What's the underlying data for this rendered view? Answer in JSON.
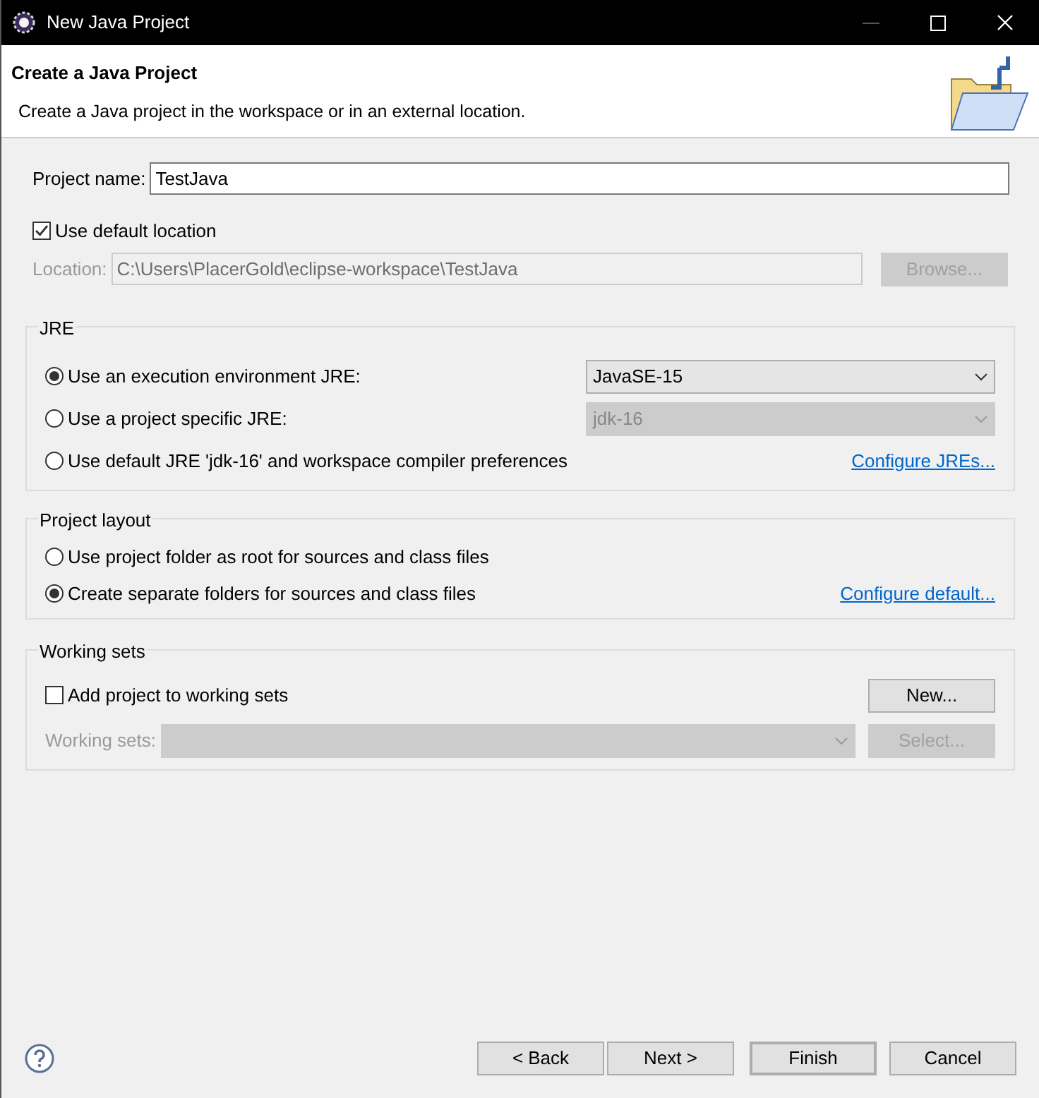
{
  "window": {
    "title": "New Java Project"
  },
  "header": {
    "title": "Create a Java Project",
    "description": "Create a Java project in the workspace or in an external location."
  },
  "project_name": {
    "label": "Project name:",
    "value": "TestJava"
  },
  "use_default_location": {
    "label": "Use default location",
    "checked": true
  },
  "location": {
    "label": "Location:",
    "value": "C:\\Users\\PlacerGold\\eclipse-workspace\\TestJava",
    "disabled": true,
    "button": {
      "label": "Browse...",
      "disabled": true
    }
  },
  "jre": {
    "title": "JRE",
    "options": [
      {
        "label": "Use an execution environment JRE:",
        "selected": true,
        "kind": "combo",
        "value": "JavaSE-15",
        "disabled": false
      },
      {
        "label": "Use a project specific JRE:",
        "selected": false,
        "kind": "combo",
        "value": "jdk-16",
        "disabled": true
      },
      {
        "label": "Use default JRE 'jdk-16' and workspace compiler preferences",
        "selected": false,
        "kind": "link",
        "link": "Configure JREs..."
      }
    ]
  },
  "project_layout": {
    "title": "Project layout",
    "options": [
      {
        "label": "Use project folder as root for sources and class files",
        "selected": false
      },
      {
        "label": "Create separate folders for sources and class files",
        "selected": true
      }
    ],
    "link": "Configure default..."
  },
  "working_sets": {
    "title": "Working sets",
    "add": {
      "label": "Add project to working sets",
      "checked": false
    },
    "new_button": {
      "label": "New...",
      "disabled": false
    },
    "sets_label": "Working sets:",
    "sets_disabled": true,
    "select_button": {
      "label": "Select...",
      "disabled": true
    }
  },
  "buttons": [
    {
      "label": "< Back",
      "default": false
    },
    {
      "label": "Next >",
      "default": false
    },
    {
      "label": "Finish",
      "default": true
    },
    {
      "label": "Cancel",
      "default": false
    }
  ]
}
